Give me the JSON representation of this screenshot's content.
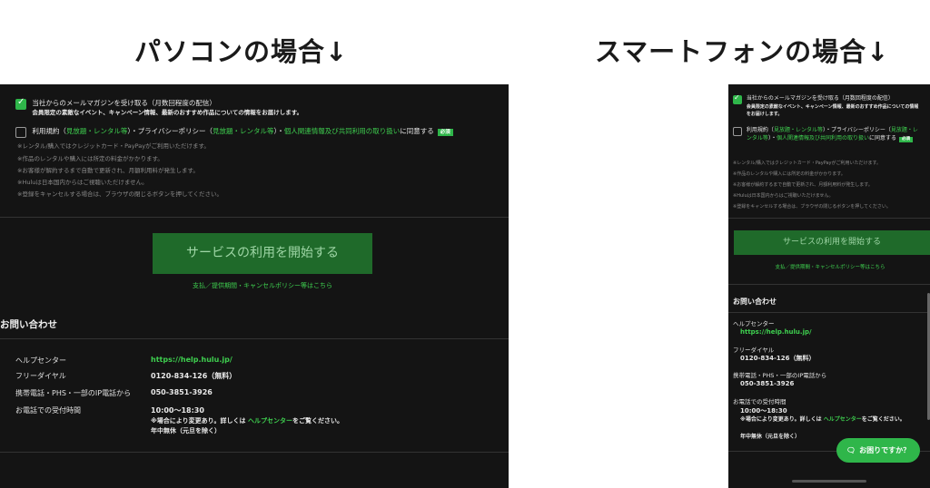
{
  "headings": {
    "pc": "パソコンの場合↓",
    "smartphone": "スマートフォンの場合↓"
  },
  "form": {
    "newsletter": {
      "checked": true,
      "label": "当社からのメールマガジンを受け取る（月数回程度の配信）",
      "sub_pc": "会員限定の素敵なイベント、キャンペーン情報、最新のおすすめ作品についての情報をお届けします。",
      "sub_sp": "会員限定の素敵なイベント、キャンペーン情報、最新のおすすめ作品についての情報をお届けします。"
    },
    "terms": {
      "checked": false,
      "parts": [
        "利用規約（",
        "見放題・レンタル等",
        "）・プライバシーポリシー（",
        "見放題・レンタル等",
        "）・",
        "個人関連情報及び共同利用の取り扱い",
        "に同意する"
      ],
      "required_badge": "必須"
    },
    "notes": [
      "※レンタル/購入ではクレジットカード・PayPayがご利用いただけます。",
      "※作品のレンタルや購入には所定の料金がかかります。",
      "※お客様が解約するまで自動で更新され、月額利用料が発生します。",
      "※Huluは日本国内からはご視聴いただけません。",
      "※登録をキャンセルする場合は、ブラウザの閉じるボタンを押してください。"
    ],
    "submit_label": "サービスの利用を開始する",
    "policy_link": "支払／提供期間・キャンセルポリシー等はこちら"
  },
  "contact": {
    "title": "お問い合わせ",
    "help_center_label": "ヘルプセンター",
    "help_center_url": "https://help.hulu.jp/",
    "free_dial_label": "フリーダイヤル",
    "free_dial_value": "0120-834-126（無料）",
    "mobile_label": "携帯電話・PHS・一部のIP電話から",
    "mobile_value": "050-3851-3926",
    "hours_label": "お電話での受付時間",
    "hours_value": "10:00～18:30",
    "hours_note_prefix": "※場合により変更あり。詳しくは ",
    "hours_note_link": "ヘルプセンター",
    "hours_note_suffix": "をご覧ください。",
    "hours_closed": "年中無休（元旦を除く）"
  },
  "sp_help_button": {
    "label": "お困りですか？",
    "icon": "chat-icon"
  },
  "colors": {
    "accent": "#2fb64a",
    "background": "#141414",
    "link": "#3ecf4f"
  }
}
